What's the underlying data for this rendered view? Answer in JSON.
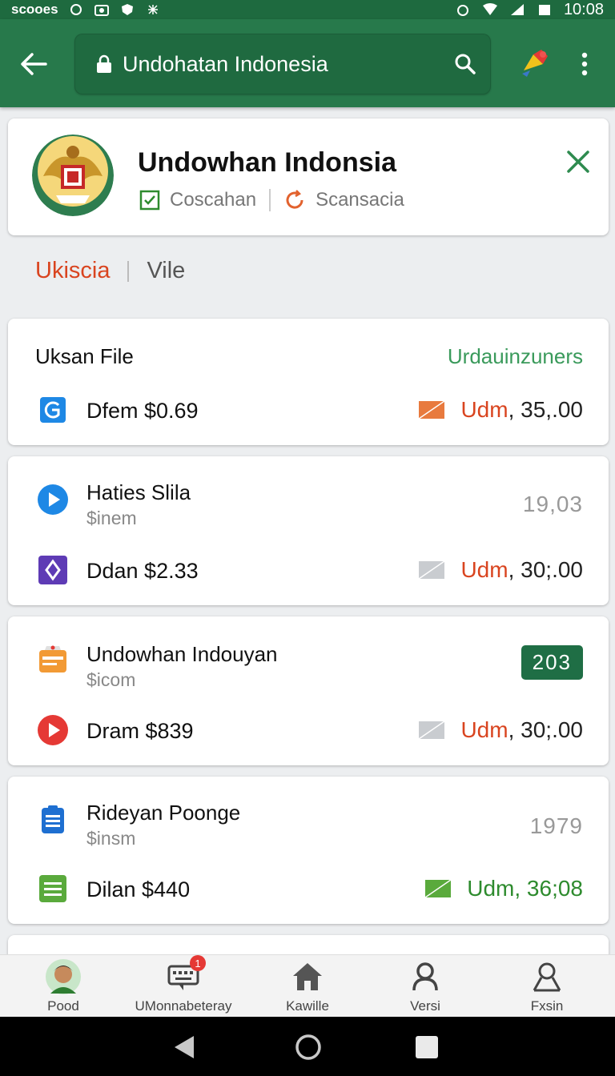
{
  "status_bar": {
    "left_text": "scooes",
    "time": "10:08"
  },
  "search": {
    "value": "Undohatan Indonesia"
  },
  "header": {
    "title": "Undowhan Indonsia",
    "meta1": "Coscahan",
    "meta2": "Scansacia"
  },
  "tabs": [
    {
      "label": "Ukiscia"
    },
    {
      "label": "Vile"
    }
  ],
  "cards": [
    {
      "title": "Uksan File",
      "link": "Urdauinzuners",
      "row_text": "Dfem $0.69",
      "udm": "Udm",
      "amount": "35,.00"
    },
    {
      "title": "Haties Slila",
      "sub": "$inem",
      "value": "19,03",
      "row_text": "Ddan $2.33",
      "udm": "Udm",
      "amount": "30;.00"
    },
    {
      "title": "Undowhan Indouyan",
      "sub": "$icom",
      "badge": "203",
      "row_text": "Dram $839",
      "udm": "Udm",
      "amount": "30;.00"
    },
    {
      "title": "Rideyan Poonge",
      "sub": "$insm",
      "value": "1979",
      "row_text": "Dilan $440",
      "udm": "Udm",
      "amount": "36;08"
    }
  ],
  "bottom_nav": [
    {
      "label": "Pood"
    },
    {
      "label": "UMonnabeteray",
      "badge": "1"
    },
    {
      "label": "Kawille"
    },
    {
      "label": "Versi"
    },
    {
      "label": "Fxsin"
    }
  ],
  "colors": {
    "primary": "#27794b",
    "accent_red": "#d9441f",
    "accent_green": "#2e8b2e"
  }
}
